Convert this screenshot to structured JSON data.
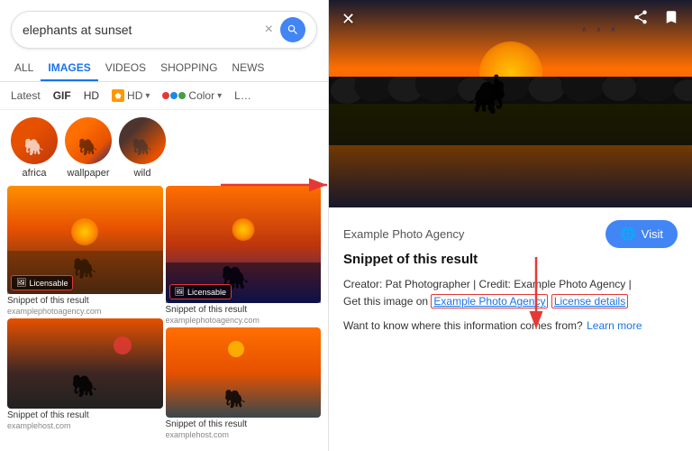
{
  "search": {
    "query": "elephants at sunset",
    "placeholder": "elephants at sunset",
    "clear_label": "×"
  },
  "tabs": [
    {
      "label": "ALL",
      "active": false
    },
    {
      "label": "IMAGES",
      "active": true
    },
    {
      "label": "VIDEOS",
      "active": false
    },
    {
      "label": "SHOPPING",
      "active": false
    },
    {
      "label": "NEWS",
      "active": false
    }
  ],
  "filters": [
    {
      "label": "Latest"
    },
    {
      "label": "GIF"
    },
    {
      "label": "HD"
    },
    {
      "label": "Product",
      "has_icon": true
    },
    {
      "label": "Color",
      "has_color": true
    },
    {
      "label": "L..."
    }
  ],
  "topics": [
    {
      "label": "africa",
      "style": "africa"
    },
    {
      "label": "wallpaper",
      "style": "wallpaper"
    },
    {
      "label": "wild",
      "style": "wild"
    }
  ],
  "grid": {
    "col1": [
      {
        "snippet": "Snippet of this result",
        "source": "examplephotoagency.com",
        "licensable": true
      },
      {
        "snippet": "Snippet of this result",
        "source": "examplehost.com",
        "licensable": false
      }
    ],
    "col2": [
      {
        "snippet": "Snippet of this result",
        "source": "examplephotoagency.com",
        "licensable": true
      },
      {
        "snippet": "Snippet of this result",
        "source": "examplehost.com",
        "licensable": false
      }
    ]
  },
  "detail": {
    "agency": "Example Photo Agency",
    "visit_label": "Visit",
    "snippet_title": "Snippet of this result",
    "creator_text": "Creator: Pat Photographer | Credit: Example Photo Agency |",
    "get_image_text": "Get this image on",
    "agency_link": "Example Photo Agency",
    "license_link": "License details",
    "learn_more_prefix": "Want to know where this information comes from?",
    "learn_more_label": "Learn more"
  },
  "icons": {
    "search": "🔍",
    "close": "✕",
    "share": "⬆",
    "bookmark": "🔖",
    "globe": "🌐",
    "image": "🖼",
    "licensable": "🖼"
  },
  "colors": {
    "blue_accent": "#4285f4",
    "red_arrow": "#e53935",
    "tab_active": "#1a73e8",
    "link_color": "#1a73e8"
  }
}
